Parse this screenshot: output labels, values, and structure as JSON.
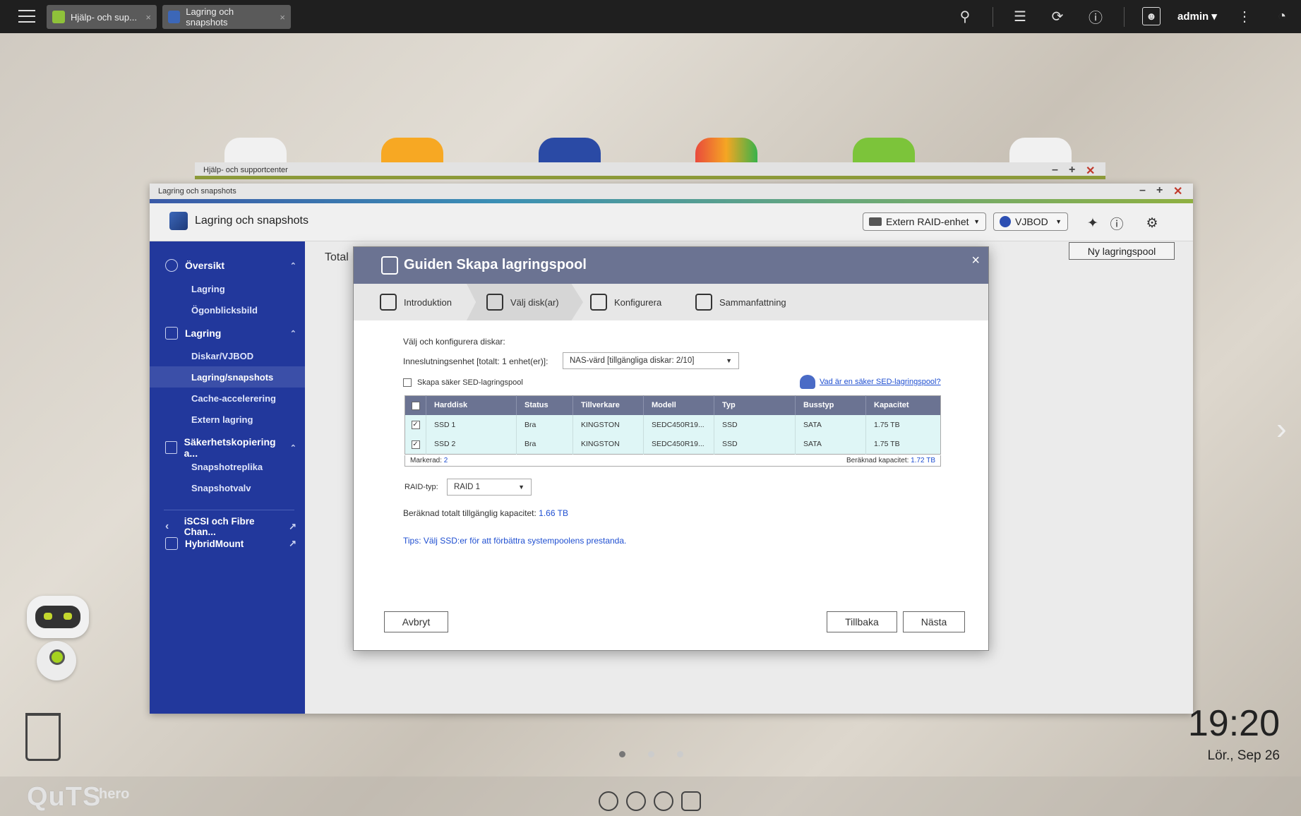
{
  "topbar": {
    "tabs": [
      {
        "label": "Hjälp- och sup...",
        "close": "×"
      },
      {
        "label": "Lagring och snapshots",
        "close": "×"
      }
    ],
    "user": "admin"
  },
  "help_window": {
    "title": "Hjälp- och supportcenter"
  },
  "main_window": {
    "title": "Lagring och snapshots",
    "app_title": "Lagring och snapshots",
    "header_buttons": {
      "external_raid": "Extern RAID-enhet",
      "vjbod": "VJBOD"
    },
    "content_label": "Total",
    "new_pool_button": "Ny lagringspool"
  },
  "sidebar": {
    "sections": [
      {
        "label": "Översikt",
        "items": [
          "Lagring",
          "Ögonblicksbild"
        ]
      },
      {
        "label": "Lagring",
        "items": [
          "Diskar/VJBOD",
          "Lagring/snapshots",
          "Cache-accelerering",
          "Extern lagring"
        ]
      },
      {
        "label": "Säkerhetskopiering a...",
        "items": [
          "Snapshotreplika",
          "Snapshotvalv"
        ]
      }
    ],
    "links": [
      "iSCSI och Fibre Chan...",
      "HybridMount"
    ]
  },
  "dialog": {
    "title": "Guiden Skapa lagringspool",
    "close": "×",
    "steps": [
      "Introduktion",
      "Välj disk(ar)",
      "Konfigurera",
      "Sammanfattning"
    ],
    "section_title": "Välj och konfigurera diskar:",
    "enclosure_label": "Inneslutningsenhet [totalt: 1 enhet(er)]:",
    "enclosure_value": "NAS-värd [tillgängliga diskar: 2/10]",
    "sed_checkbox_label": "Skapa säker SED-lagringspool",
    "sed_link": "Vad är en säker SED-lagringspool?",
    "table": {
      "headers": [
        "Harddisk",
        "Status",
        "Tillverkare",
        "Modell",
        "Typ",
        "Busstyp",
        "Kapacitet"
      ],
      "rows": [
        [
          "SSD 1",
          "Bra",
          "KINGSTON",
          "SEDC450R19...",
          "SSD",
          "SATA",
          "1.75 TB"
        ],
        [
          "SSD 2",
          "Bra",
          "KINGSTON",
          "SEDC450R19...",
          "SSD",
          "SATA",
          "1.75 TB"
        ]
      ],
      "selected_label": "Markerad:",
      "selected_value": "2",
      "est_capacity_label": "Beräknad kapacitet:",
      "est_capacity_value": "1.72 TB"
    },
    "raid_label": "RAID-typ:",
    "raid_value": "RAID 1",
    "total_capacity_label": "Beräknad totalt tillgänglig kapacitet:",
    "total_capacity_value": "1.66 TB",
    "tip": "Tips: Välj SSD:er för att förbättra systempoolens prestanda.",
    "buttons": {
      "cancel": "Avbryt",
      "back": "Tillbaka",
      "next": "Nästa"
    }
  },
  "desktop": {
    "clock": "19:20",
    "date": "Lör., Sep 26",
    "brand": "QuTS",
    "brand_sup": "hero"
  }
}
